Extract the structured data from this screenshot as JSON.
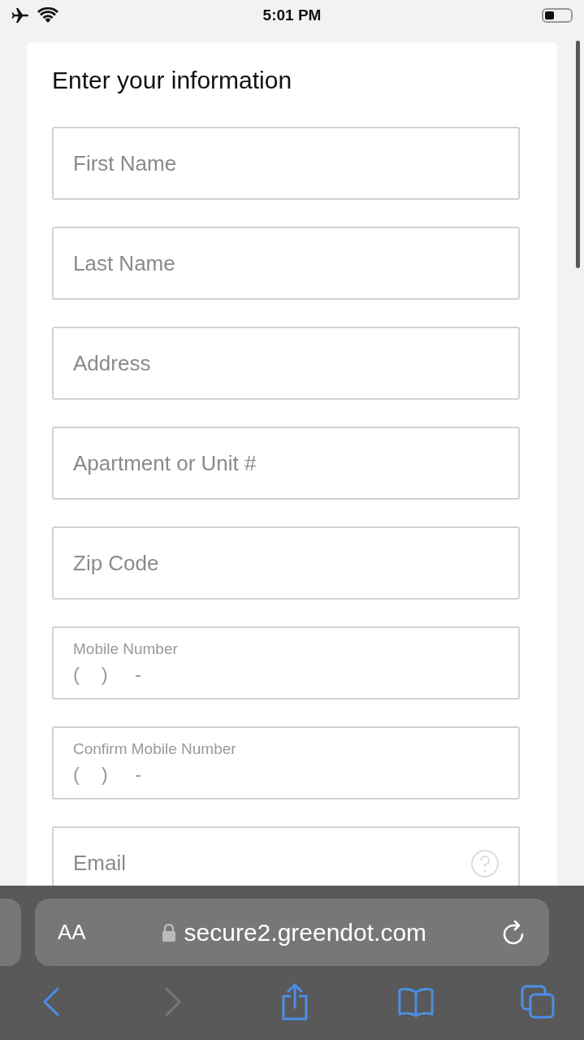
{
  "status_bar": {
    "time": "5:01 PM",
    "airplane_mode": true
  },
  "form": {
    "title": "Enter your information",
    "fields": [
      {
        "kind": "plain",
        "placeholder": "First Name"
      },
      {
        "kind": "plain",
        "placeholder": "Last Name"
      },
      {
        "kind": "plain",
        "placeholder": "Address"
      },
      {
        "kind": "plain",
        "placeholder": "Apartment or Unit #"
      },
      {
        "kind": "plain",
        "placeholder": "Zip Code"
      },
      {
        "kind": "phone",
        "label": "Mobile Number",
        "mask": "(    )     -"
      },
      {
        "kind": "phone",
        "label": "Confirm Mobile Number",
        "mask": "(    )     -"
      },
      {
        "kind": "plain",
        "placeholder": "Email",
        "help": true
      }
    ]
  },
  "browser": {
    "text_size": "AA",
    "url": "secure2.greendot.com",
    "toolbar": [
      {
        "kind": "back",
        "disabled": false
      },
      {
        "kind": "forward",
        "disabled": true
      },
      {
        "kind": "share",
        "disabled": false
      },
      {
        "kind": "bookmarks",
        "disabled": false
      },
      {
        "kind": "tabs",
        "disabled": false
      }
    ]
  }
}
